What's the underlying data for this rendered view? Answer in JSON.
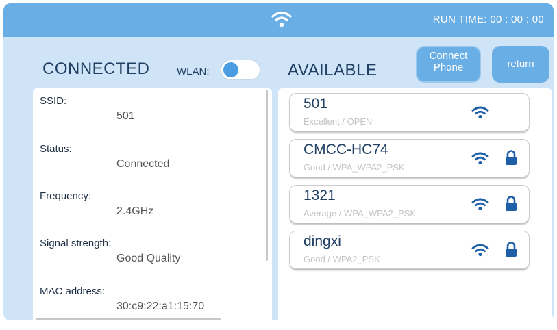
{
  "header": {
    "wifi_icon": "wifi-icon",
    "run_time": "RUN TIME: 00 : 00 : 00"
  },
  "connected": {
    "title": "CONNECTED",
    "wlan_label": "WLAN:",
    "wlan_toggle_on": true,
    "fields": [
      {
        "label": "SSID:",
        "value": "501"
      },
      {
        "label": "Status:",
        "value": "Connected"
      },
      {
        "label": "Frequency:",
        "value": "2.4GHz"
      },
      {
        "label": "Signal strength:",
        "value": "Good Quality"
      },
      {
        "label": "MAC address:",
        "value": "30:c9:22:a1:15:70"
      }
    ]
  },
  "available": {
    "title": "AVAILABLE",
    "connect_phone_line1": "Connect",
    "connect_phone_line2": "Phone",
    "return_label": "return",
    "networks": [
      {
        "ssid": "501",
        "detail": "Excellent / OPEN",
        "locked": false
      },
      {
        "ssid": "CMCC-HC74",
        "detail": "Good / WPA_WPA2_PSK",
        "locked": true
      },
      {
        "ssid": "1321",
        "detail": "Average / WPA_WPA2_PSK",
        "locked": true
      },
      {
        "ssid": "dingxi",
        "detail": "Good / WPA2_PSK",
        "locked": true
      }
    ]
  },
  "colors": {
    "accent": "#6aaee6",
    "background": "#cfe4f6",
    "text_dark": "#1f3f63",
    "icon_blue": "#1e5fa8"
  }
}
